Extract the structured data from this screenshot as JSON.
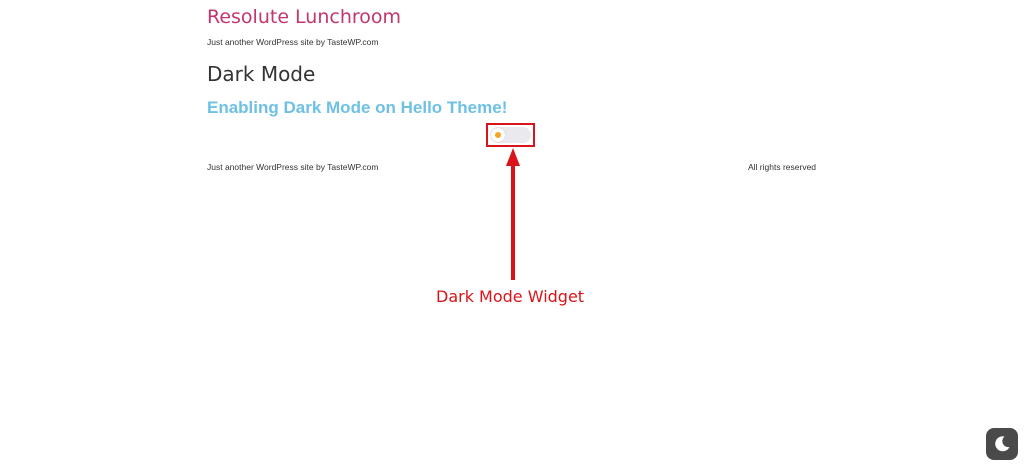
{
  "header": {
    "site_title": "Resolute Lunchroom",
    "tagline": "Just another WordPress site by TasteWP.com"
  },
  "main": {
    "page_title": "Dark Mode",
    "heading": "Enabling Dark Mode on Hello Theme!",
    "dark_mode_toggle": {
      "state": "off",
      "icon": "sun-icon"
    }
  },
  "footer": {
    "left_text": "Just another WordPress site by TasteWP.com",
    "right_text": "All rights reserved"
  },
  "annotation": {
    "label": "Dark Mode Widget",
    "color": "#d9141a"
  },
  "floating_button": {
    "icon": "moon-icon"
  },
  "colors": {
    "site_title": "#c2366f",
    "heading": "#6ec1e4",
    "text": "#333333"
  }
}
